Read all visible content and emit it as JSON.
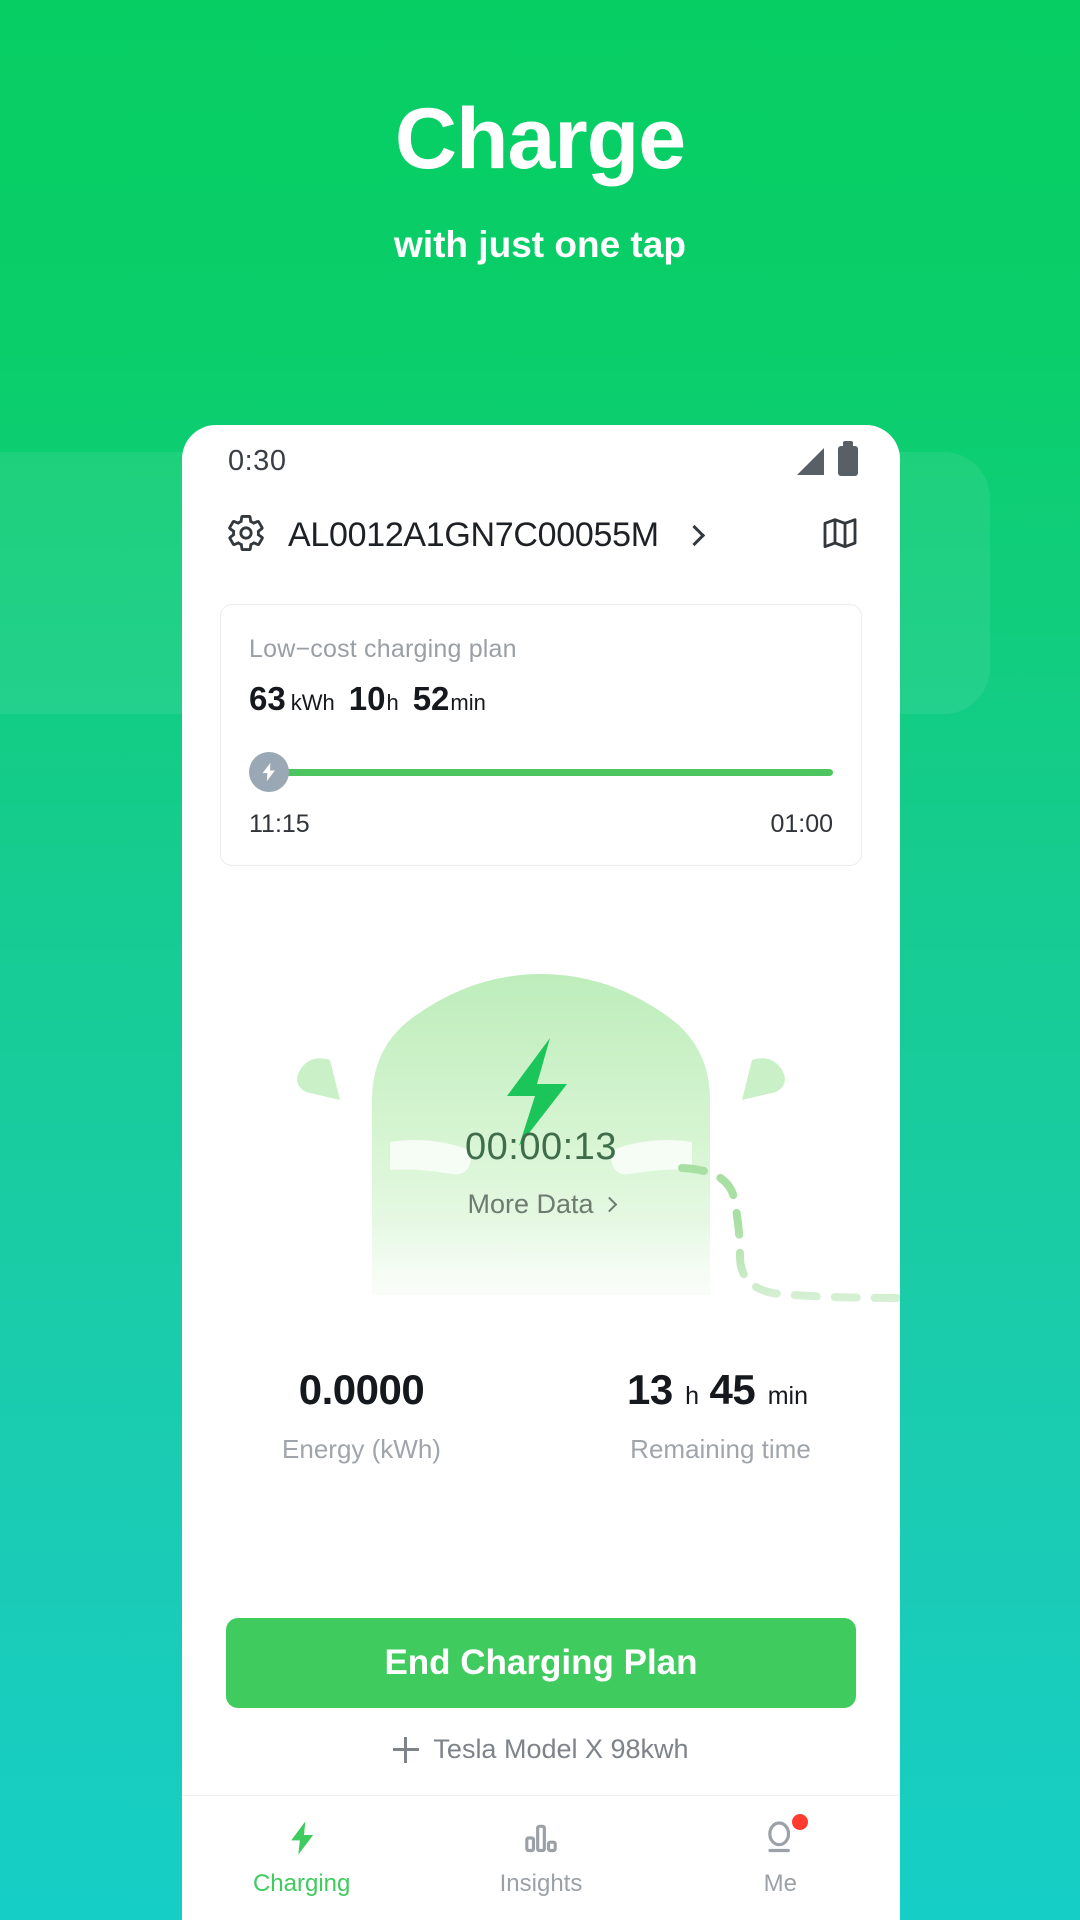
{
  "hero": {
    "title": "Charge",
    "subtitle": "with just one tap"
  },
  "phone": {
    "statusbar": {
      "time": "0:30",
      "signal_icon": "signal-icon",
      "battery_icon": "battery-icon"
    },
    "header": {
      "settings_icon": "gear-icon",
      "vehicle_id": "AL0012A1GN7C00055M",
      "chevron_icon": "chevron-right-icon",
      "map_icon": "map-icon"
    },
    "plan_card": {
      "label": "Low−cost charging plan",
      "energy_value": "63",
      "energy_unit": "kWh",
      "hours_value": "10",
      "hours_unit": "h",
      "minutes_value": "52",
      "minutes_unit": "min",
      "bolt_icon": "bolt-icon",
      "start_time": "11:15",
      "end_time": "01:00",
      "progress_percent": 100
    },
    "car": {
      "bolt_icon": "bolt-icon",
      "timer": "00:00:13",
      "more_data_label": "More Data",
      "more_data_chevron": "chevron-right-icon"
    },
    "stats": [
      {
        "value": "0.0000",
        "unit": "",
        "value2": "",
        "unit2": "",
        "label": "Energy (kWh)"
      },
      {
        "value": "13",
        "unit": "h",
        "value2": "45",
        "unit2": "min",
        "label": "Remaining time"
      }
    ],
    "cta": {
      "label": "End Charging Plan"
    },
    "add_vehicle": {
      "plus_icon": "plus-icon",
      "label": "Tesla Model X  98kwh"
    },
    "tabs": [
      {
        "label": "Charging",
        "icon": "bolt-icon",
        "active": true,
        "badge": false
      },
      {
        "label": "Insights",
        "icon": "bar-chart-icon",
        "active": false,
        "badge": false
      },
      {
        "label": "Me",
        "icon": "person-icon",
        "active": false,
        "badge": true
      }
    ]
  },
  "colors": {
    "bg_top": "#07CE63",
    "bg_bottom": "#15CEC6",
    "accent_green": "#3FCB5E",
    "badge_red": "#FF3B30",
    "car_fill": "#CDF0CB"
  }
}
